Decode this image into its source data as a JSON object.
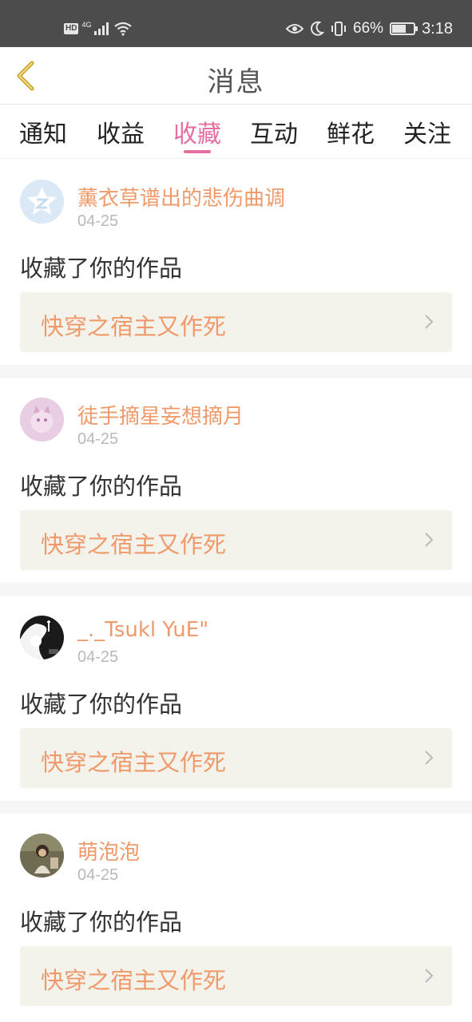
{
  "status_bar": {
    "hd": "HD",
    "network": "4G",
    "battery_percent": "66%",
    "battery_level": 0.66,
    "time": "3:18"
  },
  "header": {
    "title": "消息"
  },
  "tabs": [
    {
      "label": "通知",
      "active": false
    },
    {
      "label": "收益",
      "active": false
    },
    {
      "label": "收藏",
      "active": true
    },
    {
      "label": "互动",
      "active": false
    },
    {
      "label": "鲜花",
      "active": false
    },
    {
      "label": "关注",
      "active": false
    }
  ],
  "colors": {
    "accent": "#e46fa3",
    "username": "#ef9a6b",
    "work_box_bg": "#f3f3ec"
  },
  "messages": [
    {
      "username": "薰衣草谱出的悲伤曲调",
      "date": "04-25",
      "action": "收藏了你的作品",
      "work_title": "快穿之宿主又作死",
      "avatar_icon": "qzone-default-avatar-icon"
    },
    {
      "username": "徒手摘星妄想摘月",
      "date": "04-25",
      "action": "收藏了你的作品",
      "work_title": "快穿之宿主又作死",
      "avatar_icon": "pink-cat-avatar-icon"
    },
    {
      "username": "_._Tsukl YuE\"",
      "date": "04-25",
      "action": "收藏了你的作品",
      "work_title": "快穿之宿主又作死",
      "avatar_icon": "monochrome-avatar-icon"
    },
    {
      "username": "萌泡泡",
      "date": "04-25",
      "action": "收藏了你的作品",
      "work_title": "快穿之宿主又作死",
      "avatar_icon": "photo-avatar-icon"
    }
  ]
}
